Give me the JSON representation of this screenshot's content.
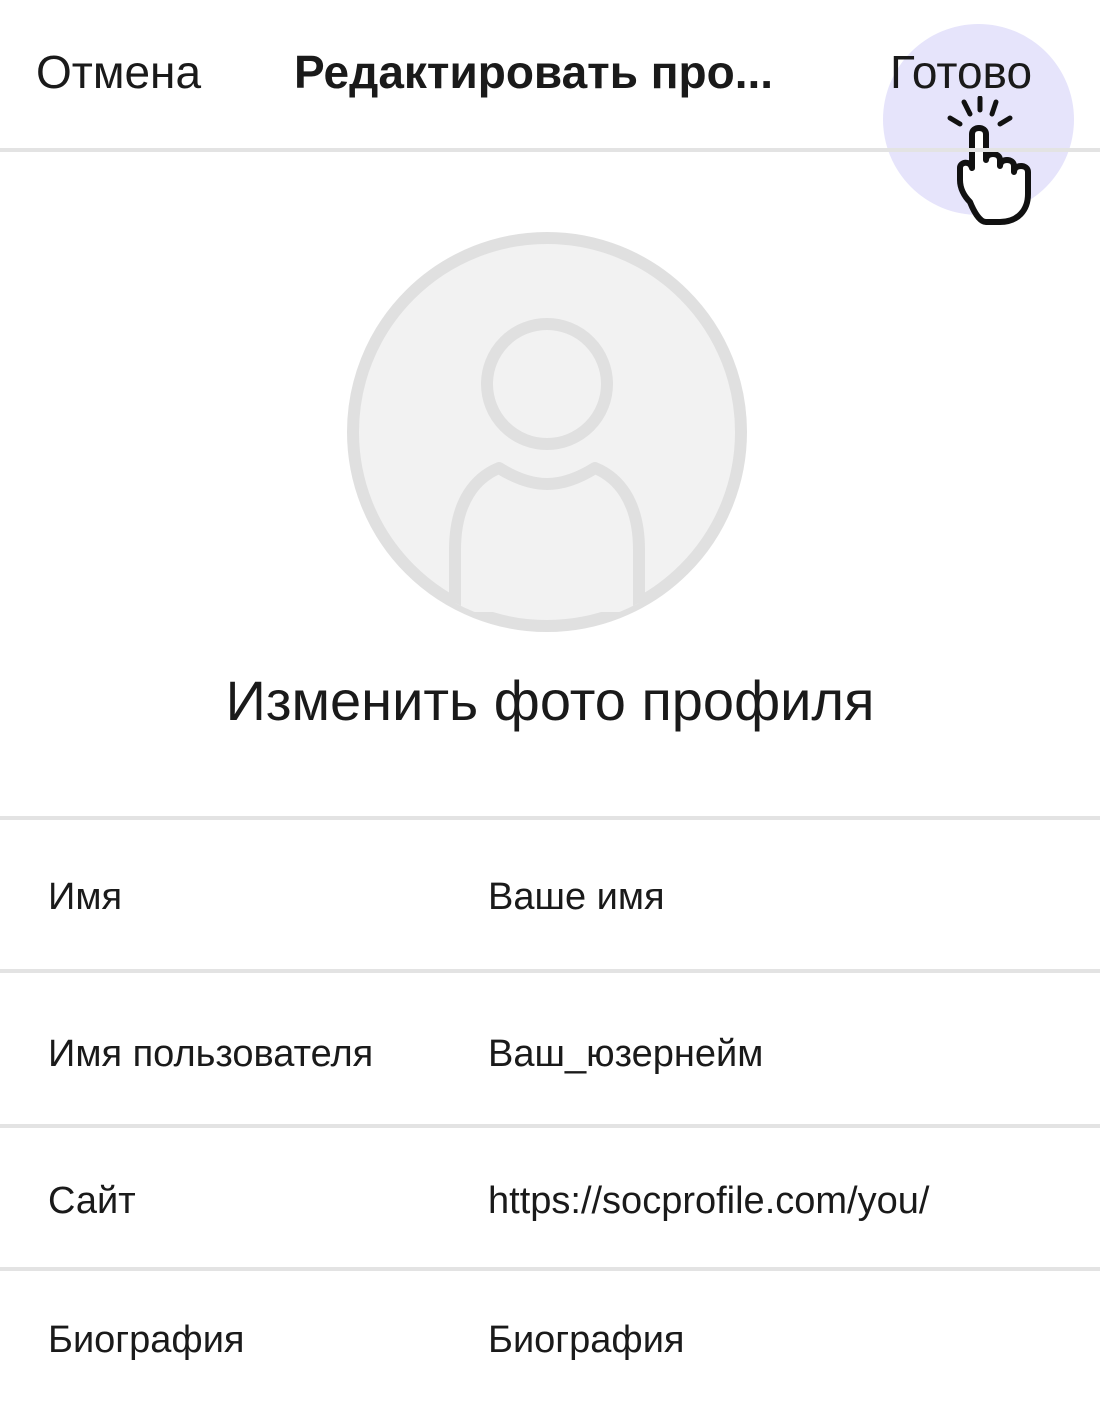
{
  "header": {
    "cancel_label": "Отмена",
    "title": "Редактировать про...",
    "done_label": "Готово"
  },
  "profile": {
    "change_photo_label": "Изменить фото профиля"
  },
  "fields": [
    {
      "label": "Имя",
      "value": "Ваше имя"
    },
    {
      "label": "Имя пользователя",
      "value": "Ваш_юзернейм"
    },
    {
      "label": "Сайт",
      "value": "https://socprofile.com/you/"
    },
    {
      "label": "Биография",
      "value": "Биография"
    }
  ],
  "colors": {
    "highlight": "#e6e4fb",
    "divider": "#e3e3e3",
    "avatar_fill": "#f2f2f2",
    "avatar_stroke": "#e0e0e0",
    "text": "#1a1a1a"
  },
  "icons": {
    "pointer": "hand-pointer-icon",
    "avatar": "default-avatar-icon"
  }
}
